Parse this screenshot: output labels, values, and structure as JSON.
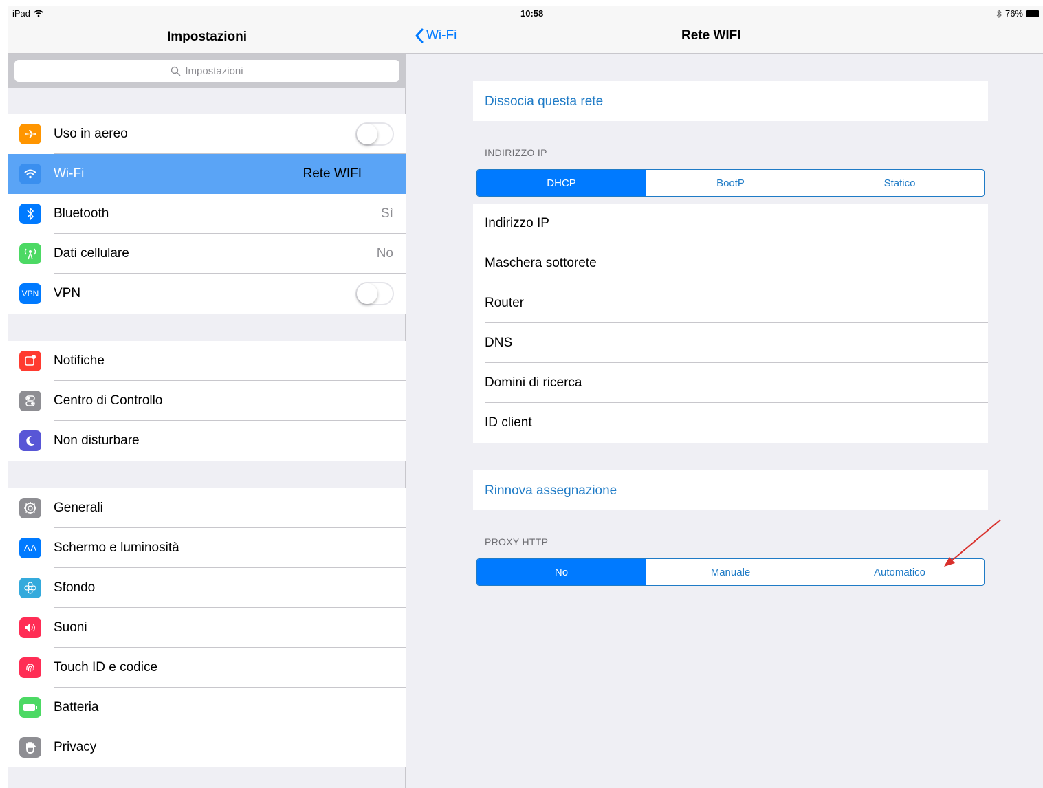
{
  "status_bar": {
    "device": "iPad",
    "time": "10:58",
    "battery": "76%"
  },
  "left_pane": {
    "title": "Impostazioni",
    "search_placeholder": "Impostazioni",
    "group1": [
      {
        "label": "Uso in aereo",
        "icon": "airplane-icon",
        "color": "#ff9500",
        "toggle": false
      },
      {
        "label": "Wi-Fi",
        "icon": "wifi-icon",
        "color": "#007aff",
        "value": "Rete WIFI",
        "selected": true
      },
      {
        "label": "Bluetooth",
        "icon": "bluetooth-icon",
        "color": "#007aff",
        "value": "Sì"
      },
      {
        "label": "Dati cellulare",
        "icon": "cellular-icon",
        "color": "#4cd964",
        "value": "No"
      },
      {
        "label": "VPN",
        "icon": "vpn-icon",
        "color": "#007aff",
        "icon_text": "VPN",
        "toggle": false
      }
    ],
    "group2": [
      {
        "label": "Notifiche",
        "icon": "notifications-icon",
        "color": "#ff3b30"
      },
      {
        "label": "Centro di Controllo",
        "icon": "control-center-icon",
        "color": "#8e8e93"
      },
      {
        "label": "Non disturbare",
        "icon": "moon-icon",
        "color": "#5856d6"
      }
    ],
    "group3": [
      {
        "label": "Generali",
        "icon": "gear-icon",
        "color": "#8e8e93"
      },
      {
        "label": "Schermo e luminosità",
        "icon": "display-icon",
        "color": "#007aff",
        "icon_text": "AA"
      },
      {
        "label": "Sfondo",
        "icon": "wallpaper-icon",
        "color": "#34aadc"
      },
      {
        "label": "Suoni",
        "icon": "sound-icon",
        "color": "#ff2d55"
      },
      {
        "label": "Touch ID e codice",
        "icon": "fingerprint-icon",
        "color": "#ff2d55"
      },
      {
        "label": "Batteria",
        "icon": "battery-icon",
        "color": "#4cd964"
      },
      {
        "label": "Privacy",
        "icon": "hand-icon",
        "color": "#8e8e93"
      }
    ]
  },
  "right_pane": {
    "back_label": "Wi-Fi",
    "title": "Rete WIFI",
    "forget_network": "Dissocia questa rete",
    "ip_section_header": "INDIRIZZO IP",
    "ip_modes": [
      "DHCP",
      "BootP",
      "Statico"
    ],
    "ip_mode_selected": "DHCP",
    "ip_rows": [
      "Indirizzo IP",
      "Maschera sottorete",
      "Router",
      "DNS",
      "Domini di ricerca",
      "ID client"
    ],
    "renew_lease": "Rinnova assegnazione",
    "proxy_section_header": "PROXY HTTP",
    "proxy_modes": [
      "No",
      "Manuale",
      "Automatico"
    ],
    "proxy_mode_selected": "No",
    "annotation_arrow_color": "#d9302c"
  }
}
